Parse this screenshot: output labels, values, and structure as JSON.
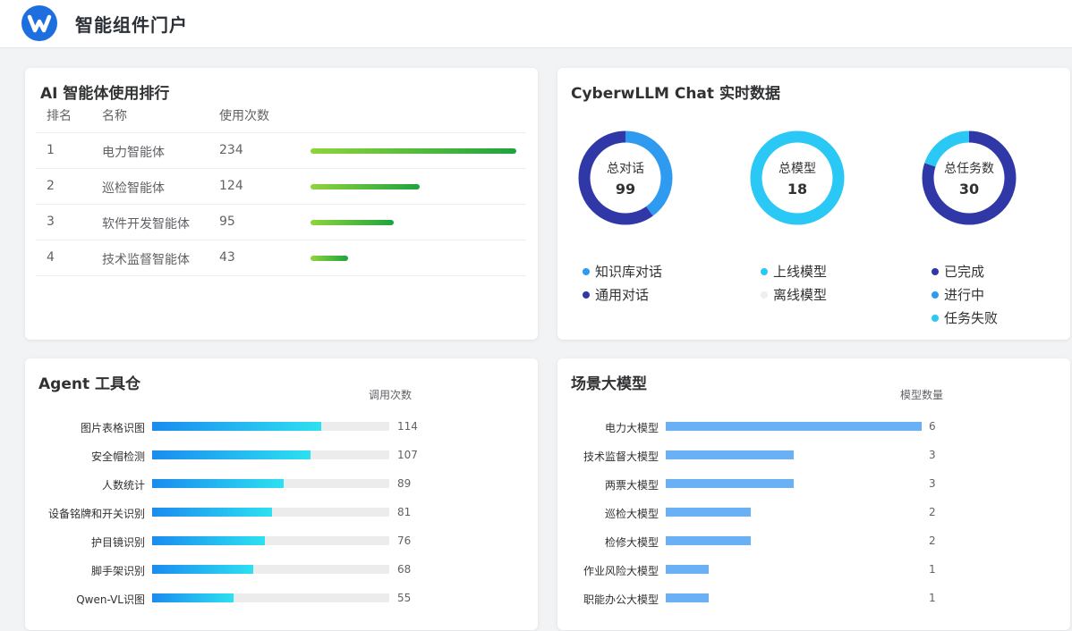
{
  "app": {
    "title": "智能组件门户"
  },
  "rank": {
    "title": "AI 智能体使用排行",
    "headers": {
      "rank": "排名",
      "name": "名称",
      "count": "使用次数"
    },
    "rows": [
      {
        "rank": "1",
        "name": "电力智能体",
        "count": 234
      },
      {
        "rank": "2",
        "name": "巡检智能体",
        "count": 124
      },
      {
        "rank": "3",
        "name": "软件开发智能体",
        "count": 95
      },
      {
        "rank": "4",
        "name": "技术监督智能体",
        "count": 43
      }
    ],
    "bar_color": "#1ea33f"
  },
  "realtime": {
    "title": "CyberwLLM Chat 实时数据",
    "donuts": [
      {
        "label": "总对话",
        "value": "99",
        "segments": [
          {
            "name": "知识库对话",
            "value": 0.4,
            "color": "#2e9bf0"
          },
          {
            "name": "通用对话",
            "value": 0.6,
            "color": "#3038a8"
          }
        ]
      },
      {
        "label": "总模型",
        "value": "18",
        "segments": [
          {
            "name": "上线模型",
            "value": 1.0,
            "color": "#29c8f5"
          },
          {
            "name": "离线模型",
            "value": 0.0,
            "color": "#eeeeee"
          }
        ]
      },
      {
        "label": "总任务数",
        "value": "30",
        "segments": [
          {
            "name": "已完成",
            "value": 0.8,
            "color": "#3038a8"
          },
          {
            "name": "进行中",
            "value": 0.0,
            "color": "#2e9bf0"
          },
          {
            "name": "任务失败",
            "value": 0.2,
            "color": "#29c8f5"
          }
        ]
      }
    ],
    "legend": {
      "col1": [
        {
          "label": "知识库对话",
          "color": "#2e9bf0"
        },
        {
          "label": "通用对话",
          "color": "#3038a8"
        }
      ],
      "col2": [
        {
          "label": "上线模型",
          "color": "#29c8f5"
        },
        {
          "label": "离线模型",
          "color": "#eeeeee"
        }
      ],
      "col3": [
        {
          "label": "已完成",
          "color": "#3038a8"
        },
        {
          "label": "进行中",
          "color": "#2e9bf0"
        },
        {
          "label": "任务失败",
          "color": "#29c8f5"
        }
      ]
    }
  },
  "chart_data": [
    {
      "type": "bar",
      "orientation": "horizontal",
      "title": "Agent 工具仓",
      "xlabel": "调用次数",
      "xlim": [
        0,
        160
      ],
      "categories": [
        "图片表格识图",
        "安全帽检测",
        "人数统计",
        "设备铭牌和开关识别",
        "护目镜识别",
        "脚手架识别",
        "Qwen-VL识图"
      ],
      "values": [
        114,
        107,
        89,
        81,
        76,
        68,
        55
      ],
      "colors": [
        "#1a8cf0",
        "#2de0f0"
      ]
    },
    {
      "type": "bar",
      "orientation": "horizontal",
      "title": "场景大模型",
      "xlabel": "模型数量",
      "xlim": [
        0,
        6
      ],
      "categories": [
        "电力大模型",
        "技术监督大模型",
        "两票大模型",
        "巡检大模型",
        "检修大模型",
        "作业风险大模型",
        "职能办公大模型"
      ],
      "values": [
        6,
        3,
        3,
        2,
        2,
        1,
        1
      ],
      "colors": [
        "#6ab0f5"
      ]
    }
  ]
}
